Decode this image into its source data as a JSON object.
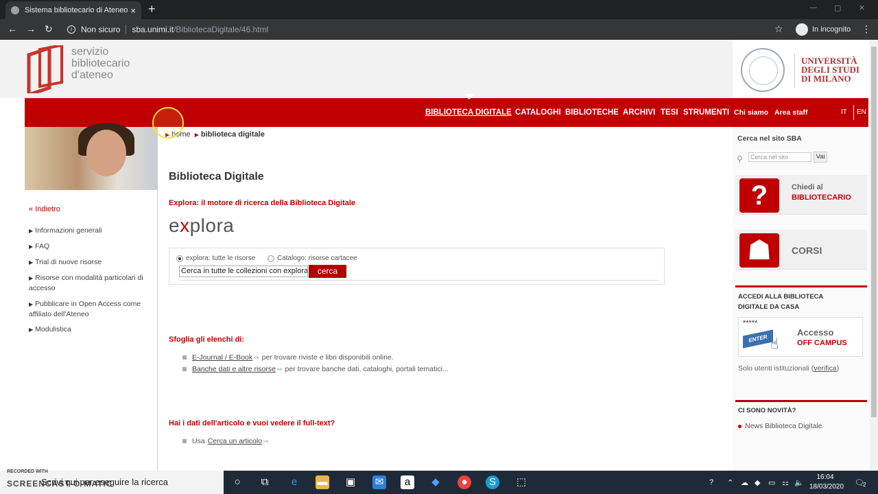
{
  "browser": {
    "tab_title": "Sistema bibliotecario di Ateneo",
    "tab_close": "×",
    "new_tab": "+",
    "security": "Non sicuro",
    "url_host": "sba.unimi.it",
    "url_path": "/BibliotecaDigitale/46.html",
    "incognito_label": "In incognito"
  },
  "header": {
    "logo_line1": "servizio",
    "logo_line2": "bibliotecario",
    "logo_line3": "d'ateneo",
    "university_line1": "UNIVERSITÀ",
    "university_line2": "DEGLI STUDI",
    "university_line3": "DI MILANO"
  },
  "nav": {
    "items": [
      "BIBLIOTECA DIGITALE",
      "CATALOGHI",
      "BIBLIOTECHE",
      "ARCHIVI",
      "TESI",
      "STRUMENTI"
    ],
    "extra": [
      "Chi siamo",
      "Area staff"
    ],
    "lang_it": "IT",
    "lang_en": "EN"
  },
  "sidebar": {
    "back": "Indietro",
    "links": [
      "Informazioni generali",
      "FAQ",
      "Trial di nuove risorse",
      "Risorse con modalità particolari di accesso",
      "Pubblicare in Open Access come affiliato dell'Ateneo",
      "Modulistica"
    ]
  },
  "breadcrumb": {
    "home": "home",
    "current": "biblioteca digitale"
  },
  "main": {
    "title": "Biblioteca Digitale",
    "explora_heading": "Explora: il motore di ricerca della Biblioteca Digitale",
    "explora_logo_pre": "e",
    "explora_logo_x": "x",
    "explora_logo_post": "plora",
    "radio_explora": "explora: tutte le risorse",
    "radio_catalogo": "Catalogo: risorse cartacee",
    "search_value": "Cerca in tutte le collezioni con explora",
    "search_button": "cerca",
    "browse_heading": "Sfoglia gli elenchi di:",
    "browse_items": [
      {
        "link": "E-Journal / E-Book",
        "desc": "per trovare riviste e libri disponibili online."
      },
      {
        "link": "Banche dati e altre risorse",
        "desc": "per trovare banche dati, cataloghi, portali tematici..."
      }
    ],
    "fulltext_heading": "Hai i dati dell'articolo e vuoi vedere il full-text?",
    "fulltext_prefix": "Usa",
    "fulltext_link": "Cerca un articolo"
  },
  "rightcol": {
    "search_title": "Cerca nel sito SBA",
    "search_placeholder": "Cerca nel sito",
    "search_button": "Vai",
    "ask_line1": "Chiedi al",
    "ask_line2": "BIBLIOTECARIO",
    "corsi": "CORSI",
    "access_heading_1": "ACCEDI ALLA BIBLIOTECA",
    "access_heading_2": "DIGITALE DA CASA",
    "access_stars": "*****",
    "access_key": "ENTER",
    "access_line1": "Accesso",
    "access_line2": "OFF CAMPUS",
    "solo_text": "Solo utenti istituzionali (",
    "solo_link": "verifica",
    "solo_end": ")",
    "news_heading": "CI SONO NOVITÀ?",
    "news_item": "News Biblioteca Digitale"
  },
  "taskbar": {
    "search_text": "Scrivi qui per eseguire la ricerca",
    "watermark_top": "RECORDED WITH",
    "watermark": "SCREENCAST-O-MATIC",
    "time": "16:04",
    "date": "18/03/2020",
    "notifications": "2"
  },
  "colors": {
    "brand_red": "#c00000",
    "taskbar": "#1f2a38",
    "chrome_dark": "#35363a"
  }
}
